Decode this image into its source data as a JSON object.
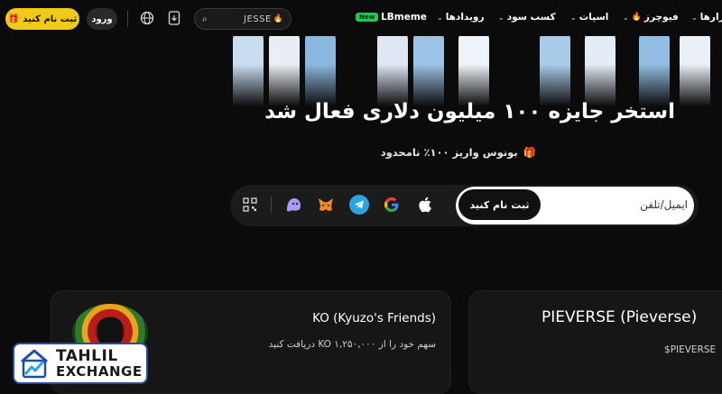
{
  "nav": {
    "register_label": "ثبت نام کنید",
    "login_label": "ورود",
    "search_query": "JESSE",
    "menu": [
      {
        "label": "بازارها"
      },
      {
        "label": "فیوچرز"
      },
      {
        "label": "اسپات"
      },
      {
        "label": "کسب سود"
      },
      {
        "label": "رویدادها"
      },
      {
        "label": "LBmeme",
        "badge": "New"
      }
    ],
    "icons": [
      "gift-icon",
      "download-icon",
      "globe-icon",
      "search-icon",
      "flame-icon",
      "chevron-down-icon"
    ]
  },
  "hero": {
    "title": "استخر جایزه ۱۰۰ میلیون دلاری فعال شد",
    "subtitle": "بونوس واریز ۱۰۰٪ نامحدود"
  },
  "signup": {
    "placeholder": "ایمیل/تلفن",
    "button_label": "ثبت نام کنید",
    "social": [
      "apple-icon",
      "google-icon",
      "telegram-icon",
      "metamask-icon",
      "ghost-icon",
      "qr-code-icon"
    ]
  },
  "cards": [
    {
      "title": "KO (Kyuzo's Friends)",
      "desc": "سهم خود را از ۱,۲۵۰,۰۰۰ KO دریافت کنید"
    },
    {
      "title": "PIEVERSE (Pieverse)",
      "desc": "PIEVERSE$"
    }
  ],
  "logo": {
    "line1": "TAHLIL",
    "line2": "EXCHANGE"
  },
  "colors": {
    "accent": "#f0c919",
    "background": "#0b0b0b",
    "new_badge": "#26c55a"
  }
}
